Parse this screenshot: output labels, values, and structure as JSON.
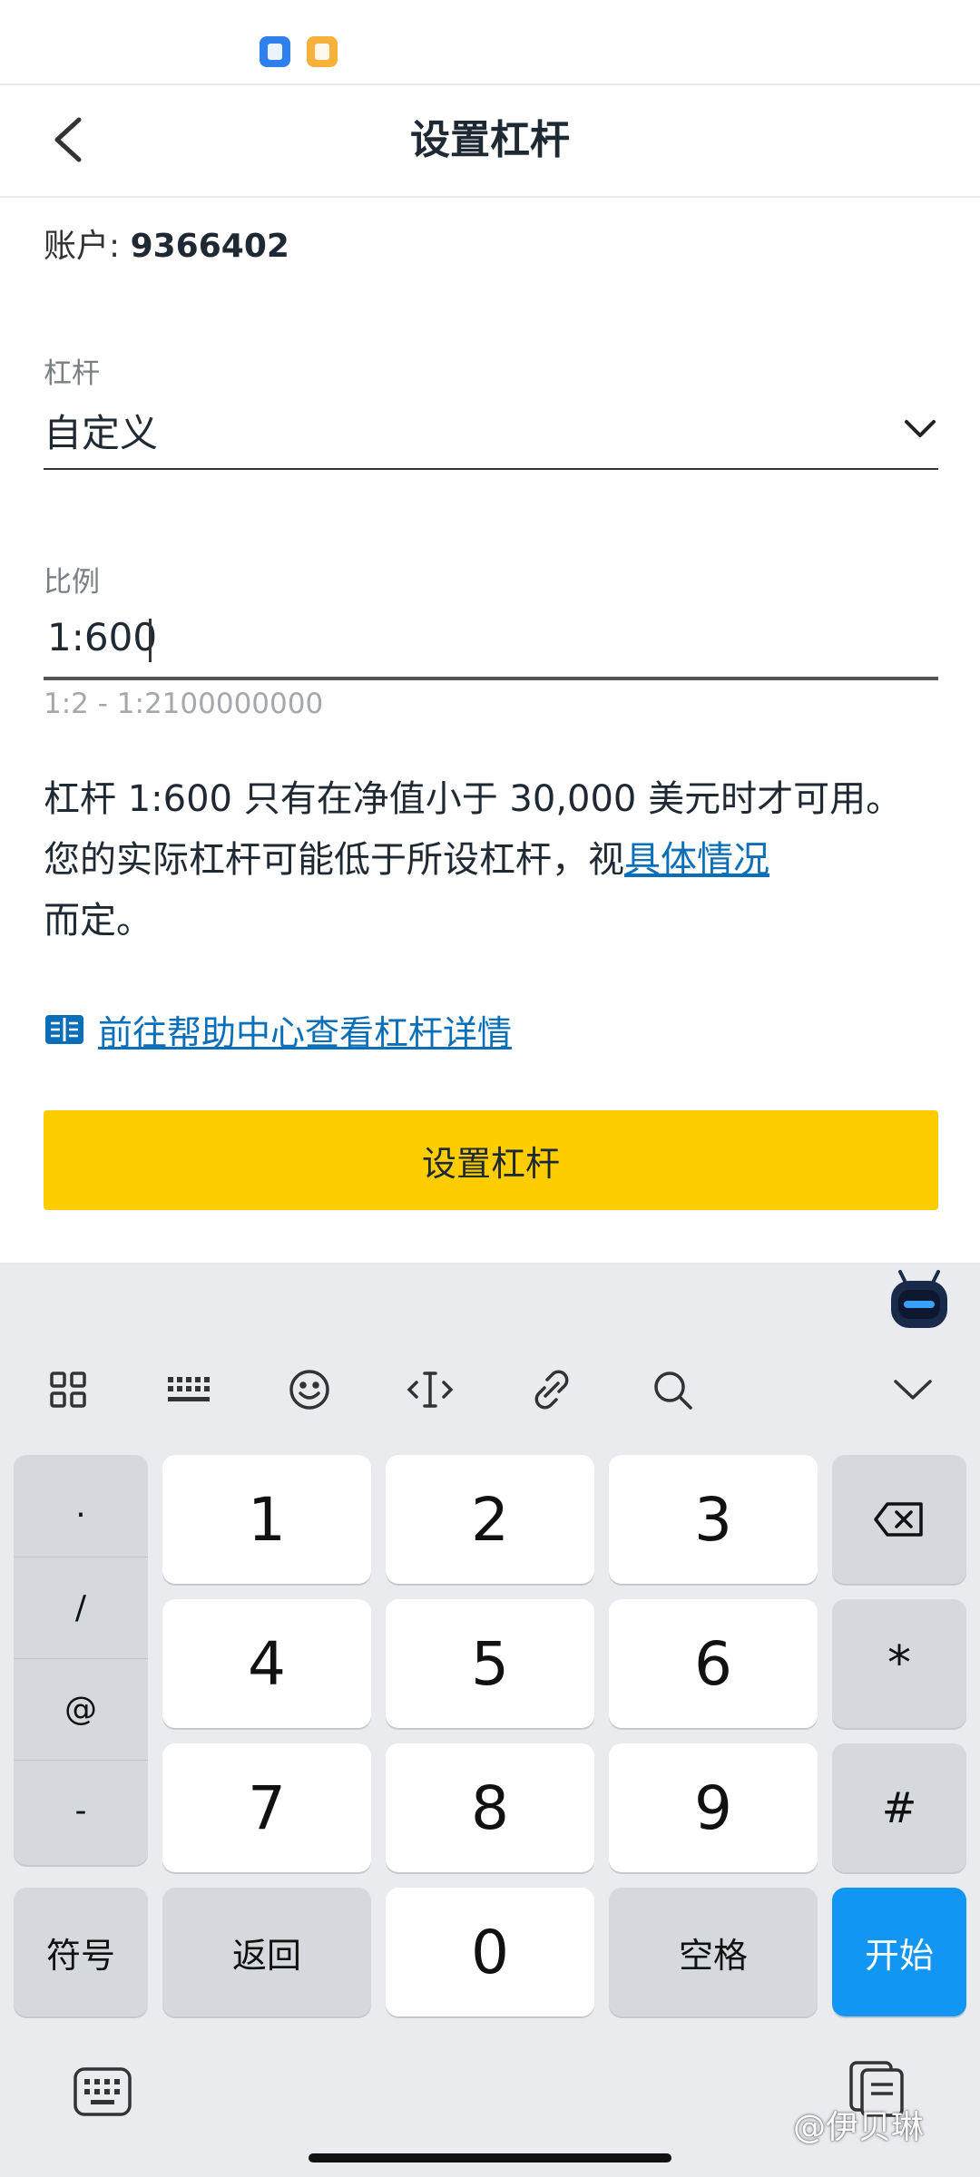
{
  "header": {
    "title": "设置杠杆"
  },
  "account": {
    "label": "账户: ",
    "number": "9366402"
  },
  "leverage": {
    "label": "杠杆",
    "value": "自定义"
  },
  "ratio": {
    "label": "比例",
    "value": "1:600",
    "hint": "1:2 - 1:2100000000"
  },
  "description": {
    "text": "杠杆 1:600 只有在净值小于 30,000 美元时才可用。 您的实际杠杆可能低于所设杠杆，视",
    "link": "具体情况",
    "suffix": "而定。"
  },
  "help": {
    "link_text": "前往帮助中心查看杠杆详情"
  },
  "submit": {
    "label": "设置杠杆"
  },
  "colors": {
    "accent": "#fdcd00",
    "link": "#0a6fb8",
    "keyboard_action": "#1296f4"
  },
  "keyboard": {
    "toolbar_icons": [
      "grid-icon",
      "keyboard-layout-icon",
      "emoji-icon",
      "cursor-move-icon",
      "link-icon",
      "search-icon",
      "collapse-keyboard-icon"
    ],
    "symbols": [
      ".",
      "/",
      "@",
      "-"
    ],
    "digits": [
      "1",
      "2",
      "3",
      "4",
      "5",
      "6",
      "7",
      "8",
      "9",
      "0"
    ],
    "star": "*",
    "hash": "#",
    "symbol_key": "符号",
    "back_key": "返回",
    "space_key": "空格",
    "go_key": "开始"
  },
  "watermark": "@伊贝琳"
}
